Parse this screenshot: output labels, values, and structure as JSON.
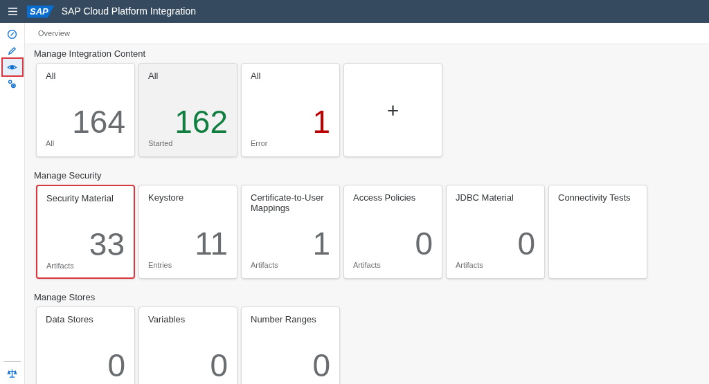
{
  "header": {
    "logo": "SAP",
    "title": "SAP Cloud Platform Integration"
  },
  "sidebar": {
    "items": [
      {
        "kind": "compass",
        "selected": false
      },
      {
        "kind": "pencil",
        "selected": false
      },
      {
        "kind": "eye",
        "selected": true
      },
      {
        "kind": "gears",
        "selected": false
      }
    ],
    "footer_item": {
      "kind": "scales"
    }
  },
  "breadcrumb": "Overview",
  "sections": [
    {
      "title": "Manage Integration Content",
      "tiles": [
        {
          "kind": "tile",
          "title": "All",
          "value": "164",
          "footer": "All",
          "color": "#6a6d70",
          "hovered": false,
          "highlighted": false
        },
        {
          "kind": "tile",
          "title": "All",
          "value": "162",
          "footer": "Started",
          "color": "#107e3e",
          "hovered": true,
          "highlighted": false
        },
        {
          "kind": "tile",
          "title": "All",
          "value": "1",
          "footer": "Error",
          "color": "#bb0000",
          "hovered": false,
          "highlighted": false
        },
        {
          "kind": "add",
          "symbol": "+",
          "hovered": false,
          "highlighted": false
        }
      ]
    },
    {
      "title": "Manage Security",
      "tiles": [
        {
          "kind": "tile",
          "title": "Security Material",
          "value": "33",
          "footer": "Artifacts",
          "color": "#6a6d70",
          "hovered": false,
          "highlighted": true
        },
        {
          "kind": "tile",
          "title": "Keystore",
          "value": "11",
          "footer": "Entries",
          "color": "#6a6d70",
          "hovered": false,
          "highlighted": false
        },
        {
          "kind": "tile",
          "title": "Certificate-to-User Mappings",
          "value": "1",
          "footer": "Artifacts",
          "color": "#6a6d70",
          "hovered": false,
          "highlighted": false
        },
        {
          "kind": "tile",
          "title": "Access Policies",
          "value": "0",
          "footer": "Artifacts",
          "color": "#6a6d70",
          "hovered": false,
          "highlighted": false
        },
        {
          "kind": "tile",
          "title": "JDBC Material",
          "value": "0",
          "footer": "Artifacts",
          "color": "#6a6d70",
          "hovered": false,
          "highlighted": false
        },
        {
          "kind": "tile",
          "title": "Connectivity Tests",
          "hovered": false,
          "highlighted": false
        }
      ]
    },
    {
      "title": "Manage Stores",
      "tiles": [
        {
          "kind": "tile",
          "title": "Data Stores",
          "value": "0",
          "color": "#6a6d70",
          "hovered": false,
          "highlighted": false
        },
        {
          "kind": "tile",
          "title": "Variables",
          "value": "0",
          "color": "#6a6d70",
          "hovered": false,
          "highlighted": false
        },
        {
          "kind": "tile",
          "title": "Number Ranges",
          "value": "0",
          "color": "#6a6d70",
          "hovered": false,
          "highlighted": false
        }
      ]
    }
  ]
}
